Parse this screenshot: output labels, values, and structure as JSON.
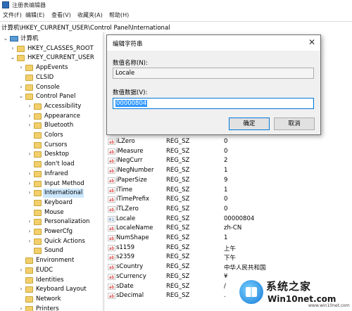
{
  "window": {
    "title": "注册表编辑器"
  },
  "menu": [
    "文件(F)",
    "编辑(E)",
    "查看(V)",
    "收藏夹(A)",
    "帮助(H)"
  ],
  "address": "计算机\\HKEY_CURRENT_USER\\Control Panel\\International",
  "tree": [
    {
      "label": "计算机",
      "icon": "computer-icon",
      "arrow": "⌄"
    },
    {
      "label": "HKEY_CLASSES_ROOT",
      "icon": "folder-icon",
      "arrow": "›"
    },
    {
      "label": "HKEY_CURRENT_USER",
      "icon": "folder-icon",
      "arrow": "⌄"
    },
    {
      "label": "AppEvents",
      "icon": "folder-icon",
      "arrow": "›"
    },
    {
      "label": "CLSID",
      "icon": "folder-icon",
      "arrow": ""
    },
    {
      "label": "Console",
      "icon": "folder-icon",
      "arrow": "›"
    },
    {
      "label": "Control Panel",
      "icon": "folder-icon",
      "arrow": "⌄"
    },
    {
      "label": "Accessibility",
      "icon": "folder-icon",
      "arrow": "›"
    },
    {
      "label": "Appearance",
      "icon": "folder-icon",
      "arrow": "›"
    },
    {
      "label": "Bluetooth",
      "icon": "folder-icon",
      "arrow": "›"
    },
    {
      "label": "Colors",
      "icon": "folder-icon",
      "arrow": ""
    },
    {
      "label": "Cursors",
      "icon": "folder-icon",
      "arrow": ""
    },
    {
      "label": "Desktop",
      "icon": "folder-icon",
      "arrow": "›"
    },
    {
      "label": "don't load",
      "icon": "folder-icon",
      "arrow": ""
    },
    {
      "label": "Infrared",
      "icon": "folder-icon",
      "arrow": "›"
    },
    {
      "label": "Input Method",
      "icon": "folder-icon",
      "arrow": "›"
    },
    {
      "label": "International",
      "icon": "folder-icon",
      "arrow": "›",
      "selected": true
    },
    {
      "label": "Keyboard",
      "icon": "folder-icon",
      "arrow": ""
    },
    {
      "label": "Mouse",
      "icon": "folder-icon",
      "arrow": ""
    },
    {
      "label": "Personalization",
      "icon": "folder-icon",
      "arrow": "›"
    },
    {
      "label": "PowerCfg",
      "icon": "folder-icon",
      "arrow": "›"
    },
    {
      "label": "Quick Actions",
      "icon": "folder-icon",
      "arrow": "›"
    },
    {
      "label": "Sound",
      "icon": "folder-icon",
      "arrow": ""
    },
    {
      "label": "Environment",
      "icon": "folder-icon",
      "arrow": ""
    },
    {
      "label": "EUDC",
      "icon": "folder-icon",
      "arrow": "›"
    },
    {
      "label": "Identities",
      "icon": "folder-icon",
      "arrow": ""
    },
    {
      "label": "Keyboard Layout",
      "icon": "folder-icon",
      "arrow": "›"
    },
    {
      "label": "Network",
      "icon": "folder-icon",
      "arrow": ""
    },
    {
      "label": "Printers",
      "icon": "folder-icon",
      "arrow": "›"
    }
  ],
  "values": [
    {
      "name": "iLZero",
      "type": "REG_SZ",
      "data": "0",
      "icon": "string-value-icon"
    },
    {
      "name": "iMeasure",
      "type": "REG_SZ",
      "data": "0",
      "icon": "string-value-icon"
    },
    {
      "name": "iNegCurr",
      "type": "REG_SZ",
      "data": "2",
      "icon": "string-value-icon"
    },
    {
      "name": "iNegNumber",
      "type": "REG_SZ",
      "data": "1",
      "icon": "string-value-icon"
    },
    {
      "name": "iPaperSize",
      "type": "REG_SZ",
      "data": "9",
      "icon": "string-value-icon"
    },
    {
      "name": "iTime",
      "type": "REG_SZ",
      "data": "1",
      "icon": "string-value-icon"
    },
    {
      "name": "iTimePrefix",
      "type": "REG_SZ",
      "data": "0",
      "icon": "string-value-icon"
    },
    {
      "name": "iTLZero",
      "type": "REG_SZ",
      "data": "0",
      "icon": "string-value-icon"
    },
    {
      "name": "Locale",
      "type": "REG_SZ",
      "data": "00000804",
      "icon": "binary-value-icon"
    },
    {
      "name": "LocaleName",
      "type": "REG_SZ",
      "data": "zh-CN",
      "icon": "string-value-icon"
    },
    {
      "name": "NumShape",
      "type": "REG_SZ",
      "data": "1",
      "icon": "string-value-icon"
    },
    {
      "name": "s1159",
      "type": "REG_SZ",
      "data": "上午",
      "icon": "string-value-icon"
    },
    {
      "name": "s2359",
      "type": "REG_SZ",
      "data": "下午",
      "icon": "string-value-icon"
    },
    {
      "name": "sCountry",
      "type": "REG_SZ",
      "data": "中华人民共和国",
      "icon": "string-value-icon"
    },
    {
      "name": "sCurrency",
      "type": "REG_SZ",
      "data": "¥",
      "icon": "string-value-icon"
    },
    {
      "name": "sDate",
      "type": "REG_SZ",
      "data": "/",
      "icon": "string-value-icon"
    },
    {
      "name": "sDecimal",
      "type": "REG_SZ",
      "data": ".",
      "icon": "string-value-icon"
    }
  ],
  "dialog": {
    "title": "编辑字符串",
    "name_label": "数值名称(N):",
    "name_value": "Locale",
    "data_label": "数值数据(V):",
    "data_value": "00000804",
    "ok": "确定",
    "cancel": "取消",
    "close": "✕"
  },
  "watermark": {
    "line1": "系统之家",
    "line2": "Win10net.com",
    "line3": "www.win10net.com"
  }
}
